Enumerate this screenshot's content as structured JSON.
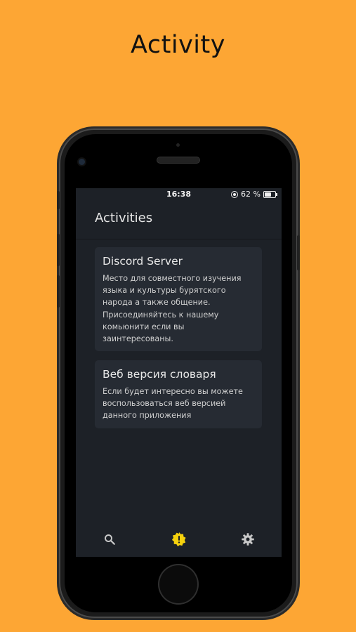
{
  "promo": {
    "title": "Activity"
  },
  "status_bar": {
    "time": "16:38",
    "battery": "62 %",
    "battery_level": 0.62
  },
  "app": {
    "title": "Activities"
  },
  "cards": [
    {
      "title": "Discord Server",
      "body": "Место для совместного изучения языка и культуры бурятского народа а также общение. Присоединяйтесь к нашему комьюнити если вы заинтересованы."
    },
    {
      "title": "Веб версия словаря",
      "body": "Если будет интересно вы можете воспользоваться веб версией данного приложения"
    }
  ],
  "nav": {
    "items": [
      {
        "icon": "search-icon",
        "active": false
      },
      {
        "icon": "activity-alert-icon",
        "active": true
      },
      {
        "icon": "gear-icon",
        "active": false
      }
    ]
  },
  "colors": {
    "background": "#FDA634",
    "screen": "#1d2127",
    "card": "#262b33",
    "accent": "#F5D10D",
    "nav_icon": "#c8c8c8"
  }
}
